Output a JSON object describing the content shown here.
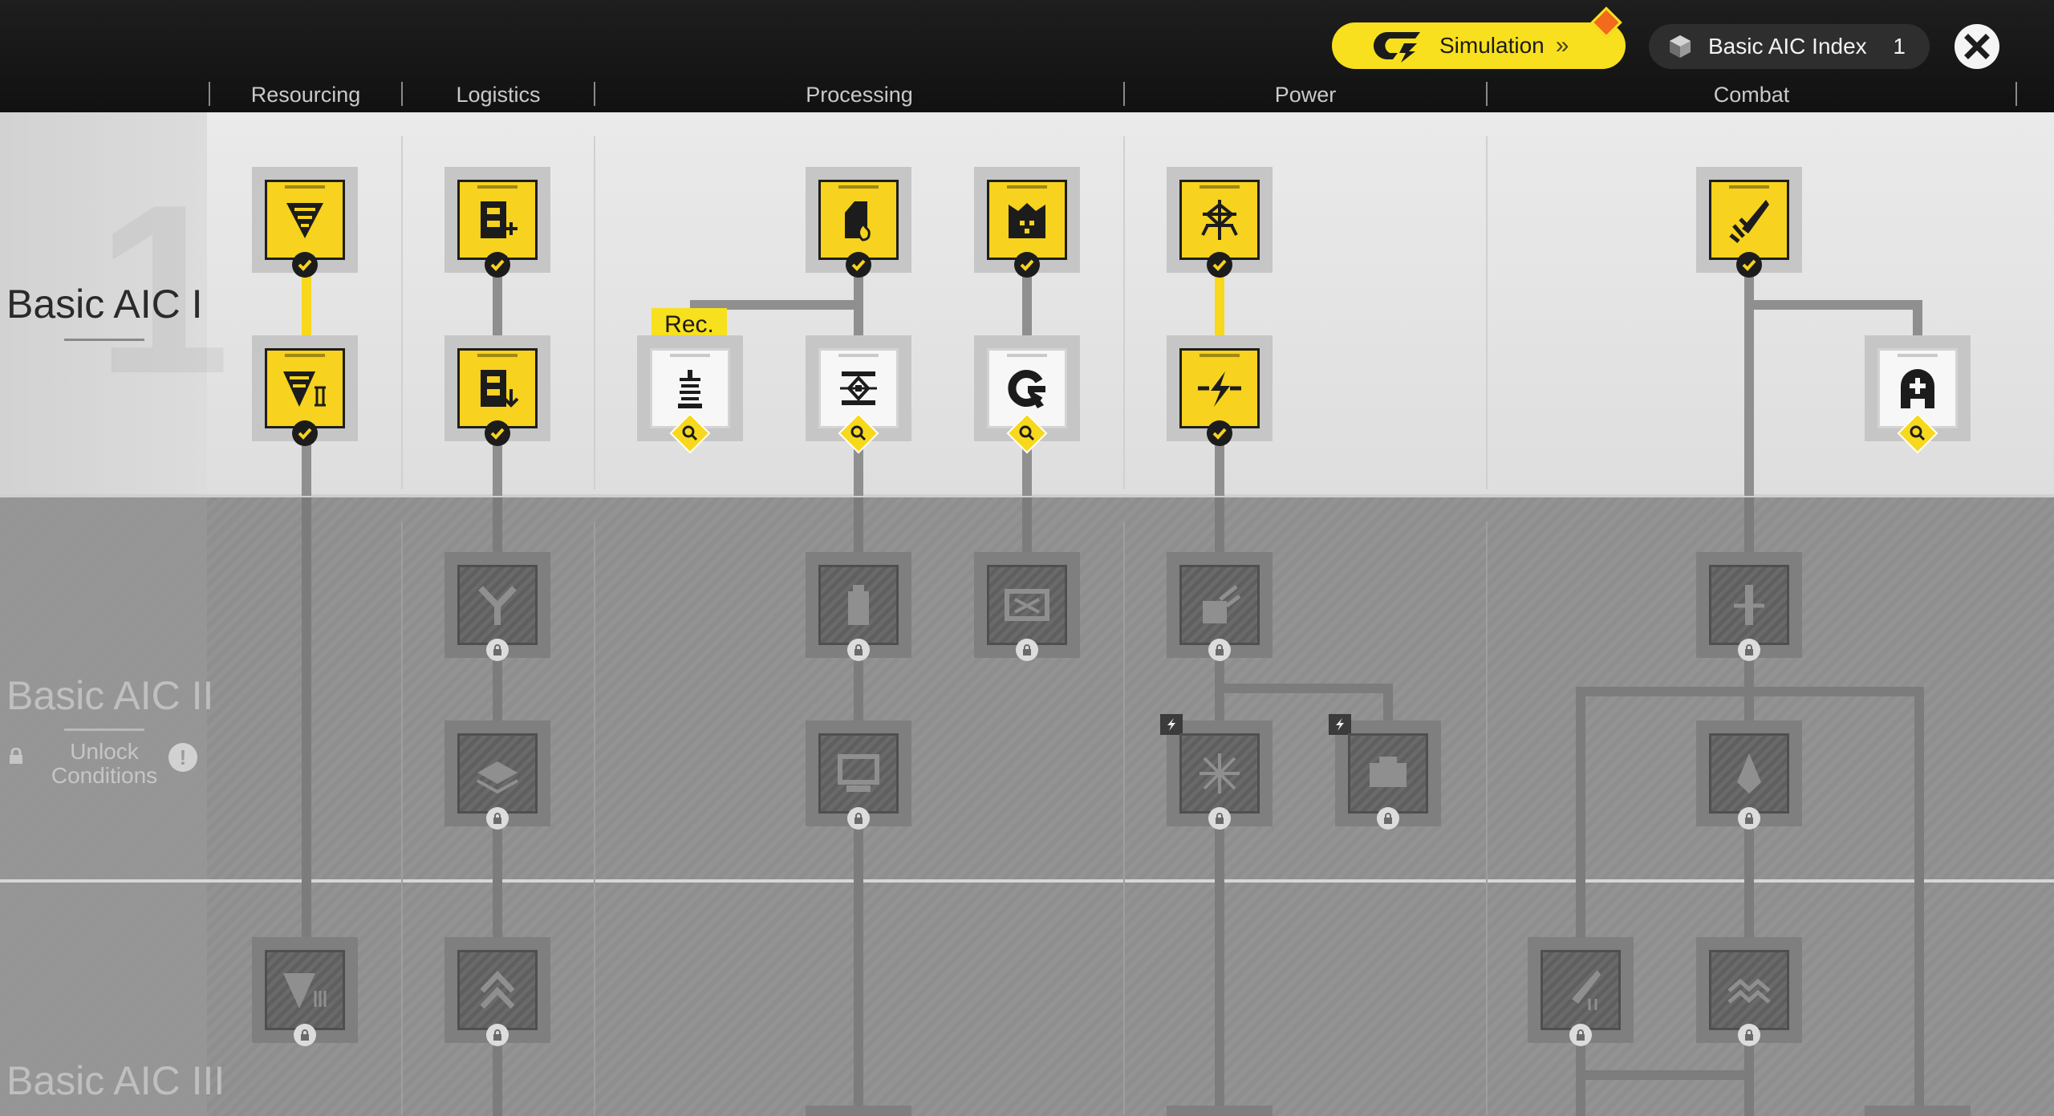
{
  "topbar": {
    "simulation_label": "Simulation",
    "simulation_arrows": "»",
    "index_label": "Basic AIC Index",
    "index_value": "1"
  },
  "categories": [
    "Resourcing",
    "Logistics",
    "Processing",
    "Power",
    "Combat"
  ],
  "tiers": {
    "t1": {
      "title": "Basic AIC I",
      "numeral": "1"
    },
    "t2": {
      "title": "Basic AIC II",
      "unlock_label": "Unlock Conditions",
      "info_glyph": "!"
    },
    "t3": {
      "title": "Basic AIC III"
    }
  },
  "rec_label": "Rec.",
  "colors": {
    "accent_yellow": "#f7d81d",
    "done_face": "#f7d21e",
    "locked_face": "#666666",
    "topbar": "#161616",
    "sim_diamond": "#f26a1c"
  },
  "nodes": [
    {
      "icon": "drill-icon",
      "state": "completed"
    },
    {
      "icon": "drill-ii-icon",
      "state": "completed"
    },
    {
      "icon": "storage-plus-icon",
      "state": "completed"
    },
    {
      "icon": "storage-down-icon",
      "state": "completed"
    },
    {
      "icon": "refinery-icon",
      "state": "available"
    },
    {
      "icon": "furnace-icon",
      "state": "completed"
    },
    {
      "icon": "crusher-icon",
      "state": "available"
    },
    {
      "icon": "factory-icon",
      "state": "completed"
    },
    {
      "icon": "gear-claw-icon",
      "state": "available"
    },
    {
      "icon": "power-pylon-icon",
      "state": "completed"
    },
    {
      "icon": "power-bolt-icon",
      "state": "completed"
    },
    {
      "icon": "turret-icon",
      "state": "completed"
    },
    {
      "icon": "medic-icon",
      "state": "available"
    },
    {
      "icon": "splitter-icon",
      "state": "locked"
    },
    {
      "icon": "layer-icon",
      "state": "locked"
    },
    {
      "icon": "canister-icon",
      "state": "locked"
    },
    {
      "icon": "monitor-icon",
      "state": "locked"
    },
    {
      "icon": "assembly-icon",
      "state": "locked"
    },
    {
      "icon": "relay-icon",
      "state": "locked"
    },
    {
      "icon": "spread-icon",
      "state": "locked"
    },
    {
      "icon": "battery-icon",
      "state": "locked"
    },
    {
      "icon": "tower-icon",
      "state": "locked"
    },
    {
      "icon": "shard-icon",
      "state": "locked"
    },
    {
      "icon": "drill-iii-icon",
      "state": "locked"
    },
    {
      "icon": "conveyor-up-icon",
      "state": "locked"
    },
    {
      "icon": "rocket-ii-icon",
      "state": "locked"
    },
    {
      "icon": "wave-icon",
      "state": "locked"
    }
  ]
}
